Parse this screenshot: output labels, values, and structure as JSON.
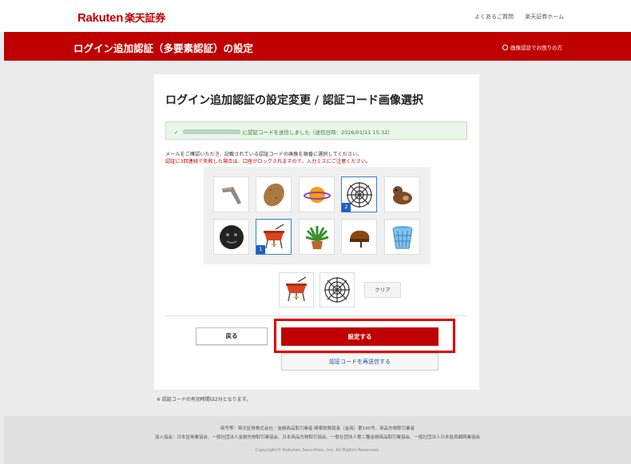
{
  "brand": {
    "name": "Rakuten",
    "jp": "楽天証券"
  },
  "header_links": {
    "faq": "よくあるご質問",
    "home": "楽天証券ホーム"
  },
  "banner": {
    "title": "ログイン追加認証（多要素認証）の設定",
    "help": "画像認証でお困りの方"
  },
  "main": {
    "heading": "ログイン追加認証の設定変更 / 認証コード画像選択",
    "notice": "に認証コードを送信しました（送信日時：2026/01/11 15:32）",
    "instruction": "メールをご確認いただき、記載されている認証コードの画像を順番に選択してください。",
    "warning": "認証に3回連続で失敗した場合は、口座がロックされますので、入力ミスにご注意ください。"
  },
  "image_grid": [
    {
      "icon": "boomerang-icon",
      "badge": ""
    },
    {
      "icon": "potato-icon",
      "badge": ""
    },
    {
      "icon": "planet-icon",
      "badge": ""
    },
    {
      "icon": "spider-web-icon",
      "badge": "2"
    },
    {
      "icon": "otter-icon",
      "badge": ""
    },
    {
      "icon": "new-moon-face-icon",
      "badge": ""
    },
    {
      "icon": "fondue-icon",
      "badge": "1"
    },
    {
      "icon": "potted-plant-icon",
      "badge": ""
    },
    {
      "icon": "flip-flop-icon",
      "badge": ""
    },
    {
      "icon": "wastebasket-icon",
      "badge": ""
    }
  ],
  "selected": [
    "fondue-icon",
    "spider-web-icon"
  ],
  "buttons": {
    "clear": "クリア",
    "back": "戻る",
    "submit": "設定する",
    "resend": "認証コードを再送信する"
  },
  "note": "※ 認証コードの有効時間は2分となります。",
  "footer": {
    "line1": "商号等：楽天証券株式会社／金融商品取引業者 関東財務局長（金商）第195号、商品先物取引業者",
    "line2": "加入協会：日本証券業協会、一般社団法人金融先物取引業協会、日本商品先物取引協会、一般社団法人第二種金融商品取引業協会、一般社団法人日本投資顧問業協会",
    "copyright": "Copyright© Rakuten Securities, Inc. All Rights Reserved."
  },
  "colors": {
    "brand_red": "#bf0000",
    "highlight_red": "#e00000",
    "link_blue": "#1e4fa0",
    "notice_green": "#2e7d32"
  }
}
